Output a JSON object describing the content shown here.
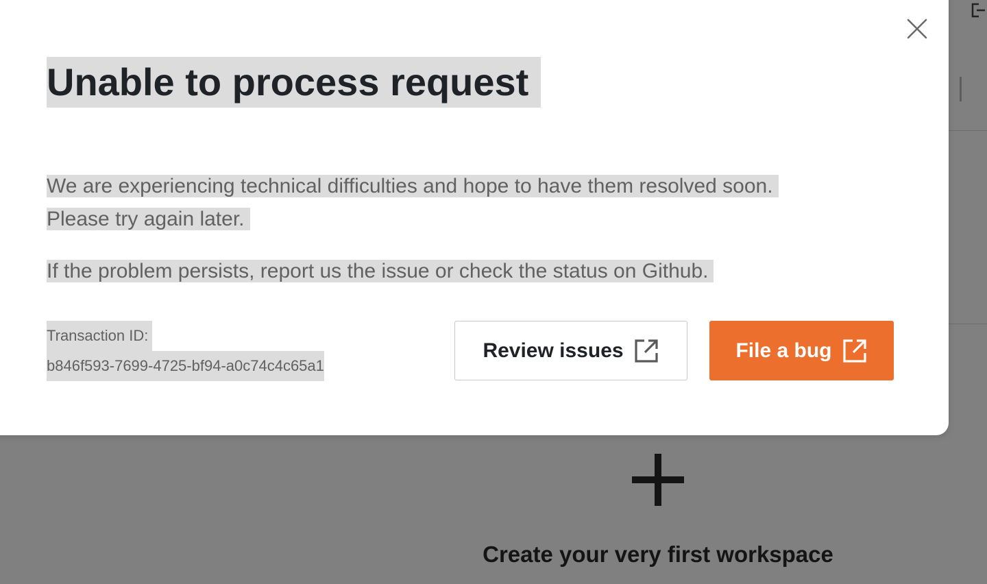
{
  "modal": {
    "title": "Unable to process request",
    "message_line1": "We are experiencing technical difficulties and hope to have them resolved soon.",
    "message_line2": "Please try again later.",
    "message_line3": "If the problem persists, report us the issue or check the status on Github.",
    "transaction_label": "Transaction ID:",
    "transaction_id": "b846f593-7699-4725-bf94-a0c74c4c65a1",
    "review_button_label": "Review issues",
    "bug_button_label": "File a bug"
  },
  "background": {
    "create_workspace_label": "Create your very first workspace"
  },
  "icons": {
    "close": "close-icon",
    "external_link": "external-link-icon",
    "plus": "plus-icon",
    "logout": "logout-icon"
  },
  "colors": {
    "accent": "#ec6f2d",
    "overlay": "#808080",
    "highlight": "#dcdcdc"
  }
}
